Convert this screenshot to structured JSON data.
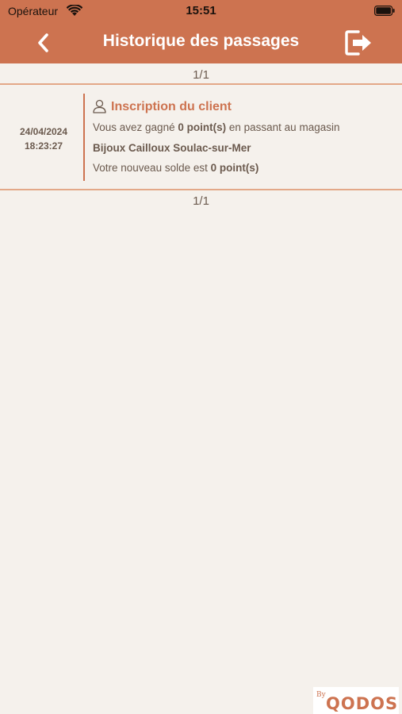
{
  "status_bar": {
    "carrier": "Opérateur",
    "time": "15:51"
  },
  "header": {
    "title": "Historique des passages"
  },
  "pagination": {
    "top": "1/1",
    "bottom": "1/1"
  },
  "entries": [
    {
      "date": "24/04/2024",
      "time": "18:23:27",
      "title": "Inscription du client",
      "line1_prefix": "Vous avez gagné",
      "line1_points": "0 point(s)",
      "line1_suffix": "en passant au magasin",
      "store": "Bijoux Cailloux Soulac-sur-Mer",
      "balance_prefix": "Votre nouveau solde est",
      "balance_points": "0 point(s)"
    }
  ],
  "brand": {
    "by": "By",
    "name": "QODOS"
  },
  "icons": {
    "back": "chevron-left-icon",
    "logout": "logout-icon",
    "person": "person-icon",
    "wifi": "wifi-icon",
    "battery": "battery-icon"
  },
  "colors": {
    "accent": "#cd7350",
    "background": "#f5f1ec",
    "text": "#6b5a4e"
  }
}
